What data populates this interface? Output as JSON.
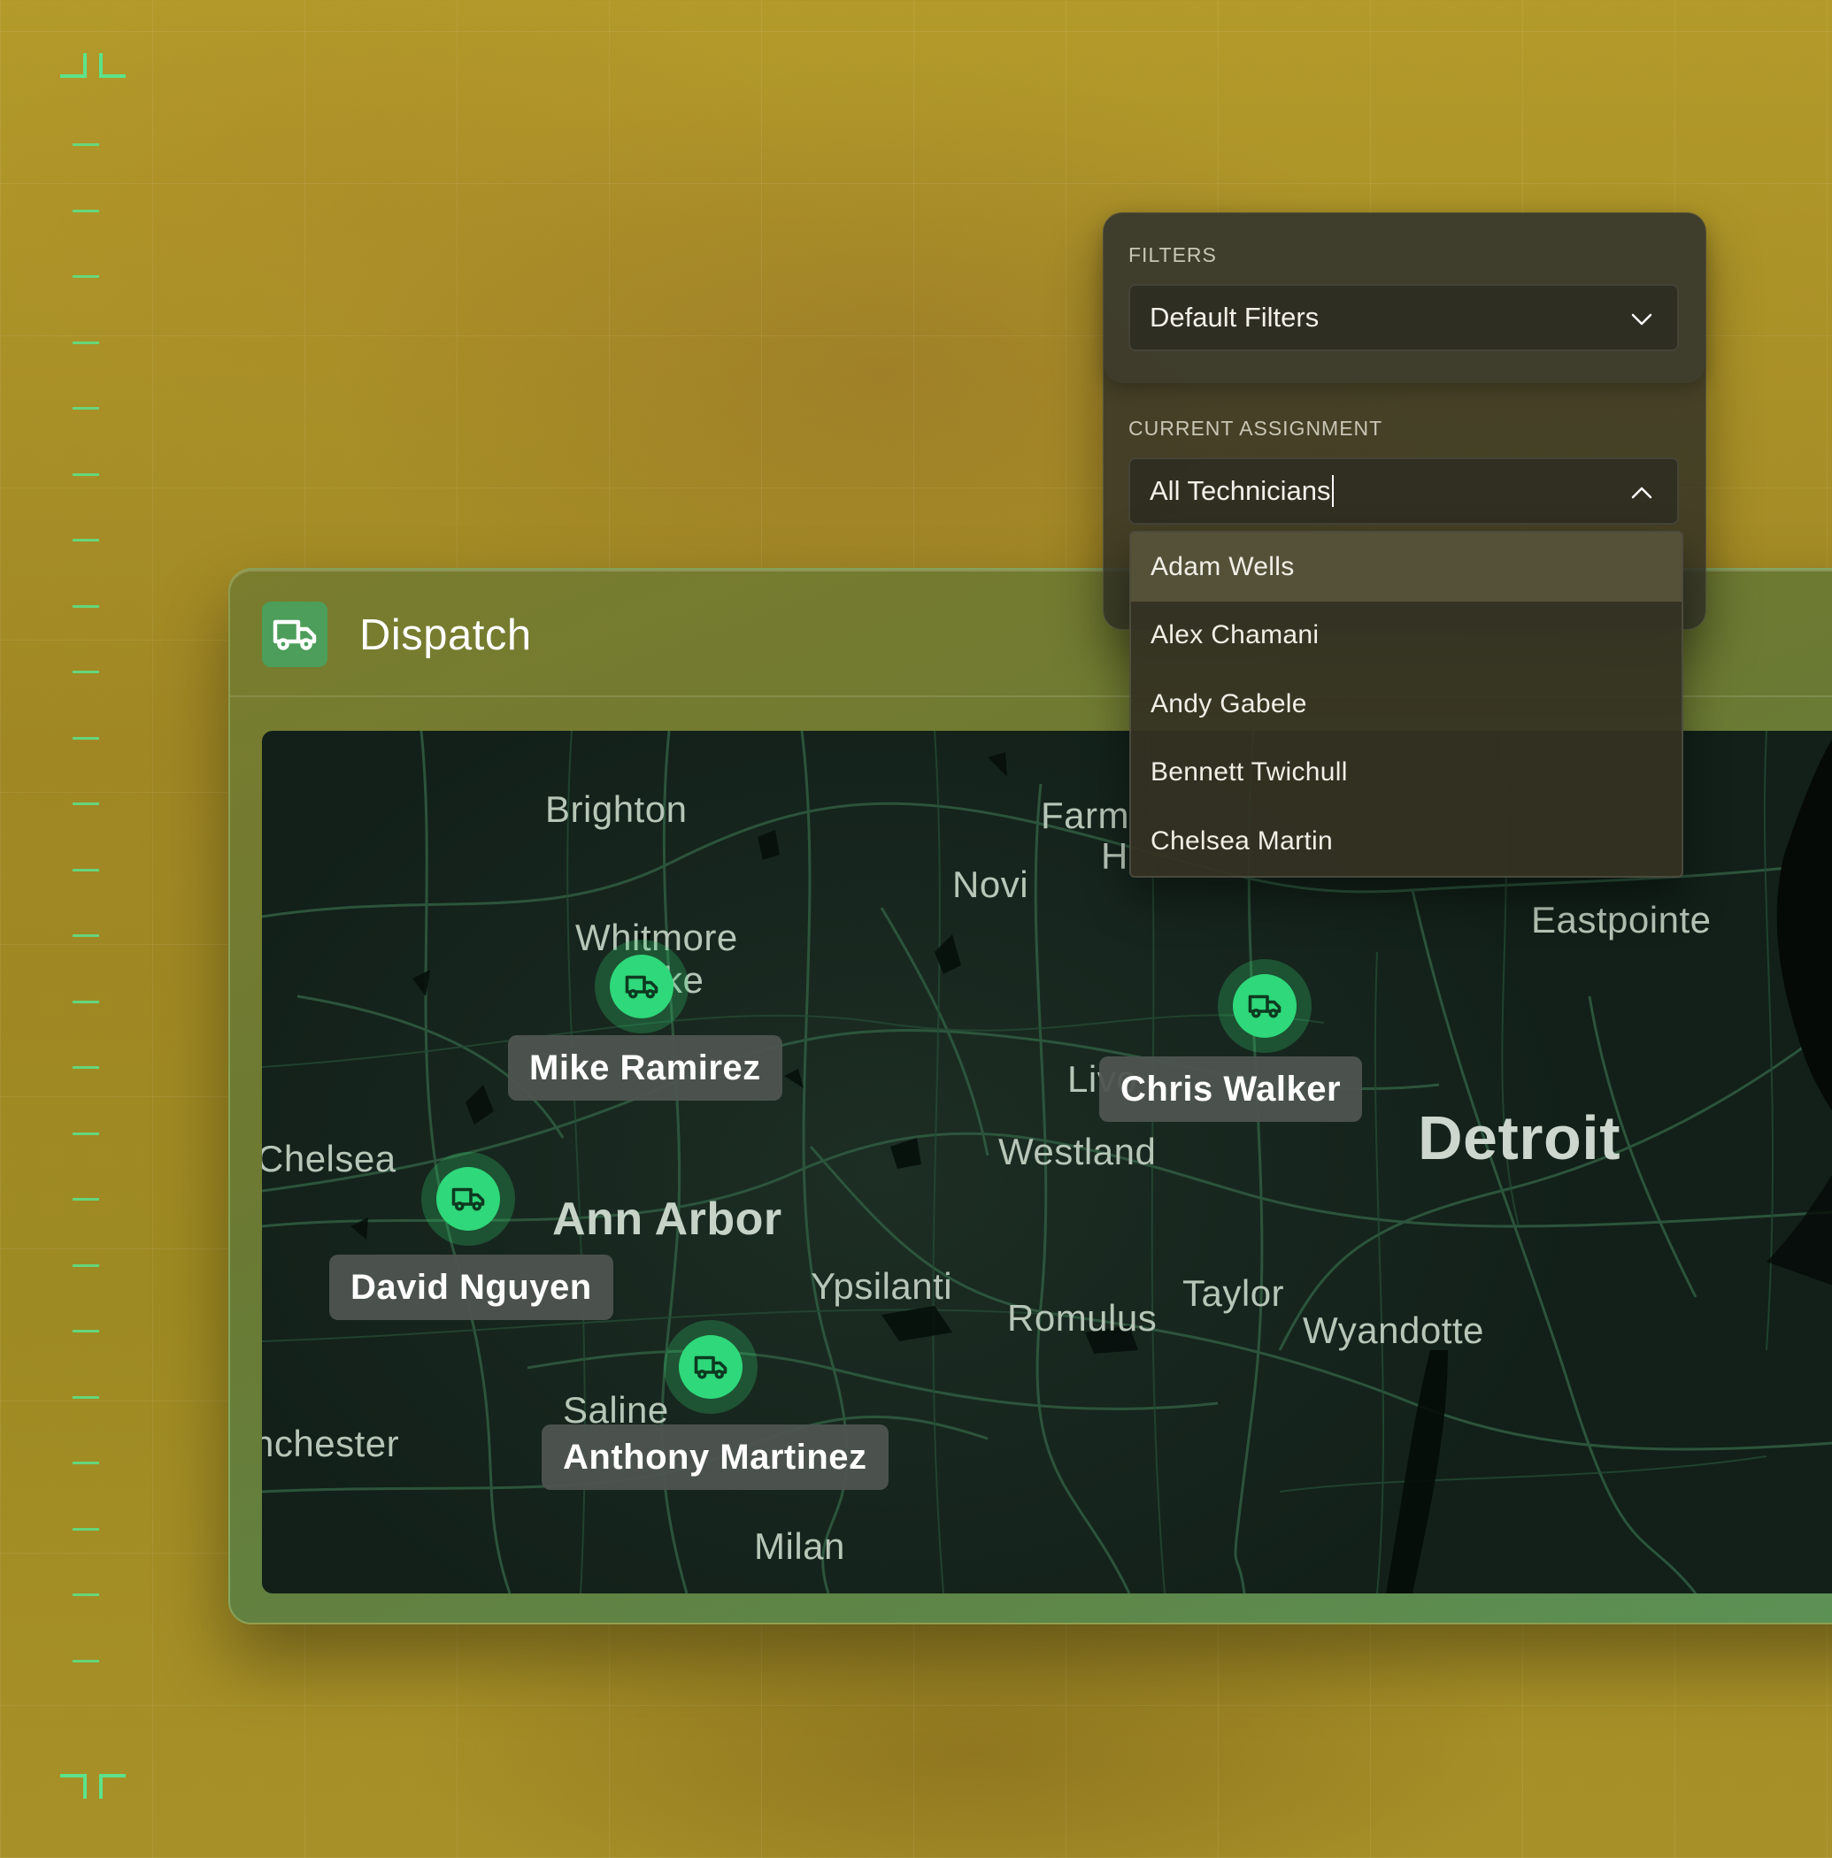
{
  "window": {
    "title": "Dispatch",
    "icon": "truck-icon"
  },
  "filters": {
    "section_label": "FILTERS",
    "selected": "Default Filters"
  },
  "assignment": {
    "section_label": "CURRENT ASSIGNMENT",
    "input_value": "All Technicians",
    "options": [
      "Adam Wells",
      "Alex Chamani",
      "Andy Gabele",
      "Bennett Twichull",
      "Chelsea Martin"
    ]
  },
  "map": {
    "cities": [
      "Brighton",
      "Farm",
      "H",
      "Novi",
      "Eastpointe",
      "Whitmore",
      "ke",
      "Livo",
      "Westland",
      "Detroit",
      "Chelsea",
      "Ann Arbor",
      "Ypsilanti",
      "Romulus",
      "Taylor",
      "Wyandotte",
      "Saline",
      "nchester",
      "Milan"
    ],
    "technicians": [
      "Mike Ramirez",
      "Chris Walker",
      "David Nguyen",
      "Anthony Martinez"
    ]
  },
  "colors": {
    "accent": "#2fd87a",
    "ruler": "#5be38b"
  }
}
